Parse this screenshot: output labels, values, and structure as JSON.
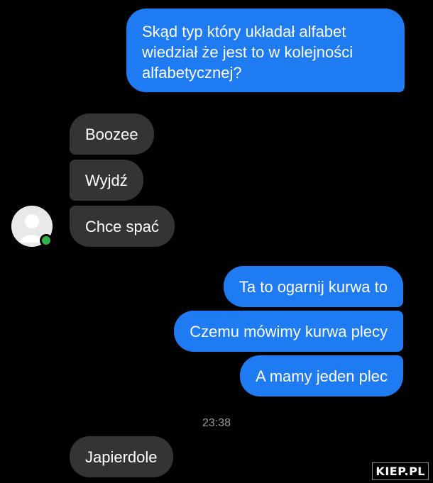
{
  "conversation": {
    "messages": [
      {
        "direction": "outgoing",
        "text": "Skąd typ który układał alfabet wiedział że jest to w kolejności alfabetycznej?"
      },
      {
        "direction": "incoming",
        "text": "Boozee"
      },
      {
        "direction": "incoming",
        "text": "Wyjdź"
      },
      {
        "direction": "incoming",
        "text": "Chce spać"
      },
      {
        "direction": "outgoing",
        "text": "Ta to ogarnij kurwa to"
      },
      {
        "direction": "outgoing",
        "text": "Czemu mówimy kurwa plecy"
      },
      {
        "direction": "outgoing",
        "text": "A mamy jeden plec"
      },
      {
        "direction": "incoming",
        "text": "Japierdole"
      }
    ],
    "timestamp": "23:38"
  },
  "contact": {
    "avatar_icon": "default-user-icon",
    "status": "online",
    "status_color": "#31b34a"
  },
  "watermark": "KIEP.PL",
  "colors": {
    "outgoing_bubble": "#1e7bf2",
    "incoming_bubble": "#333436",
    "background": "#000000",
    "timestamp_text": "#9a9a9a"
  }
}
